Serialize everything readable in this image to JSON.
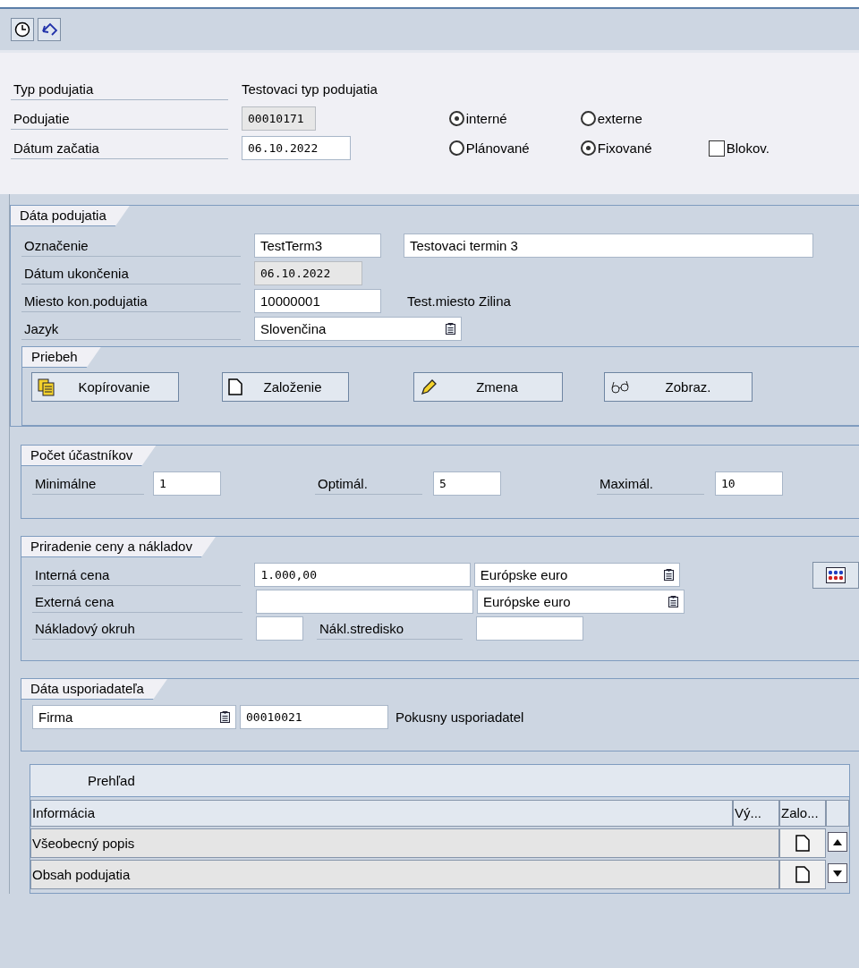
{
  "toolbar": {
    "buttons": [
      {
        "kind": "clock"
      },
      {
        "kind": "back"
      }
    ]
  },
  "header": {
    "event_type": {
      "label": "Typ podujatia",
      "value": "Testovaci typ podujatia"
    },
    "event": {
      "label": "Podujatie",
      "value": "00010171",
      "disabled": true
    },
    "start_date": {
      "label": "Dátum začatia",
      "value": "06.10.2022"
    },
    "scope_options": [
      {
        "label": "interné",
        "selected": true
      },
      {
        "label": "externe",
        "selected": false
      }
    ],
    "planning_options": [
      {
        "label": "Plánované",
        "selected": false
      },
      {
        "label": "Fixované",
        "selected": true
      }
    ],
    "blocked": {
      "label": "Blokov.",
      "checked": false
    }
  },
  "event_data": {
    "title": "Dáta podujatia",
    "designation": {
      "label": "Označenie",
      "code": "TestTerm3",
      "text": "Testovaci termin 3"
    },
    "end_date": {
      "label": "Dátum ukončenia",
      "value": "06.10.2022",
      "disabled": true
    },
    "venue": {
      "label": "Miesto kon.podujatia",
      "value": "10000001",
      "text": "Test.miesto Zilina"
    },
    "language": {
      "label": "Jazyk",
      "value": "Slovenčina"
    },
    "process": {
      "title": "Priebeh",
      "buttons": [
        {
          "kind": "copy",
          "label": "Kopírovanie"
        },
        {
          "kind": "create",
          "label": "Založenie"
        },
        {
          "kind": "edit",
          "label": "Zmena"
        },
        {
          "kind": "display",
          "label": "Zobraz."
        }
      ]
    }
  },
  "participants": {
    "title": "Počet účastníkov",
    "fields": [
      {
        "label": "Minimálne",
        "value": "1"
      },
      {
        "label": "Optimál.",
        "value": "5"
      },
      {
        "label": "Maximál.",
        "value": "10"
      }
    ]
  },
  "pricing": {
    "title": "Priradenie ceny a nákladov",
    "internal_price": {
      "label": "Interná cena",
      "value": "1.000,00",
      "currency": "Európske euro"
    },
    "external_price": {
      "label": "Externá cena",
      "currency": "Európske euro"
    },
    "cost_area": {
      "label": "Nákladový okruh"
    },
    "cost_center": {
      "label": "Nákl.stredisko"
    }
  },
  "organizer": {
    "title": "Dáta usporiadateľa",
    "type": "Firma",
    "value": "00010021",
    "text": "Pokusny usporiadatel"
  },
  "overview": {
    "title": "Prehľad",
    "columns": [
      "Informácia",
      "Vý...",
      "Zalo..."
    ],
    "rows": [
      {
        "label": "Všeobecný popis"
      },
      {
        "label": "Obsah podujatia"
      }
    ]
  }
}
